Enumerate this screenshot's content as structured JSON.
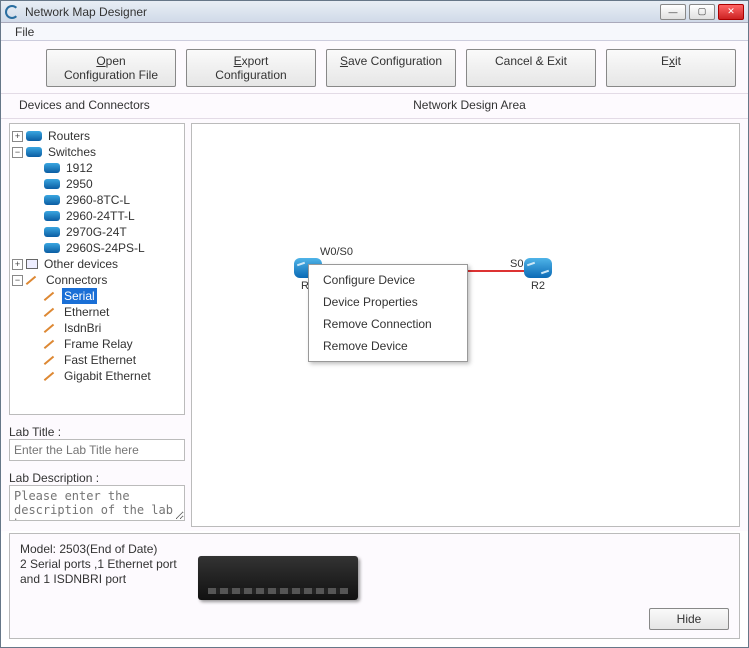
{
  "window": {
    "title": "Network Map Designer"
  },
  "menubar": {
    "file": "File"
  },
  "toolbar": {
    "open": "Open Configuration File",
    "export": "Export Configuration",
    "save": "Save Configuration",
    "cancel": "Cancel & Exit",
    "exit": "Exit"
  },
  "headers": {
    "left": "Devices and Connectors",
    "right": "Network Design Area"
  },
  "tree": {
    "routers": "Routers",
    "switches": "Switches",
    "switch_items": [
      "1912",
      "2950",
      "2960-8TC-L",
      "2960-24TT-L",
      "2970G-24T",
      "2960S-24PS-L"
    ],
    "other": "Other devices",
    "connectors": "Connectors",
    "connector_items": [
      "Serial",
      "Ethernet",
      "IsdnBri",
      "Frame Relay",
      "Fast Ethernet",
      "Gigabit Ethernet"
    ],
    "selected_connector_index": 0
  },
  "lab": {
    "title_label": "Lab Title :",
    "title_placeholder": "Enter the Lab Title here",
    "desc_label": "Lab Description :",
    "desc_placeholder": "Please enter the description of the lab here"
  },
  "canvas": {
    "device1": {
      "label": "R1"
    },
    "device2": {
      "label": "R2"
    },
    "port_w0": "W0/S0",
    "port_s0": "S0"
  },
  "context_menu": {
    "items": [
      "Configure Device",
      "Device Properties",
      "Remove Connection",
      "Remove Device"
    ]
  },
  "bottom": {
    "model_line1": "Model: 2503(End of Date)",
    "model_line2": "2 Serial ports ,1 Ethernet port and 1 ISDNBRI port",
    "hide": "Hide"
  }
}
